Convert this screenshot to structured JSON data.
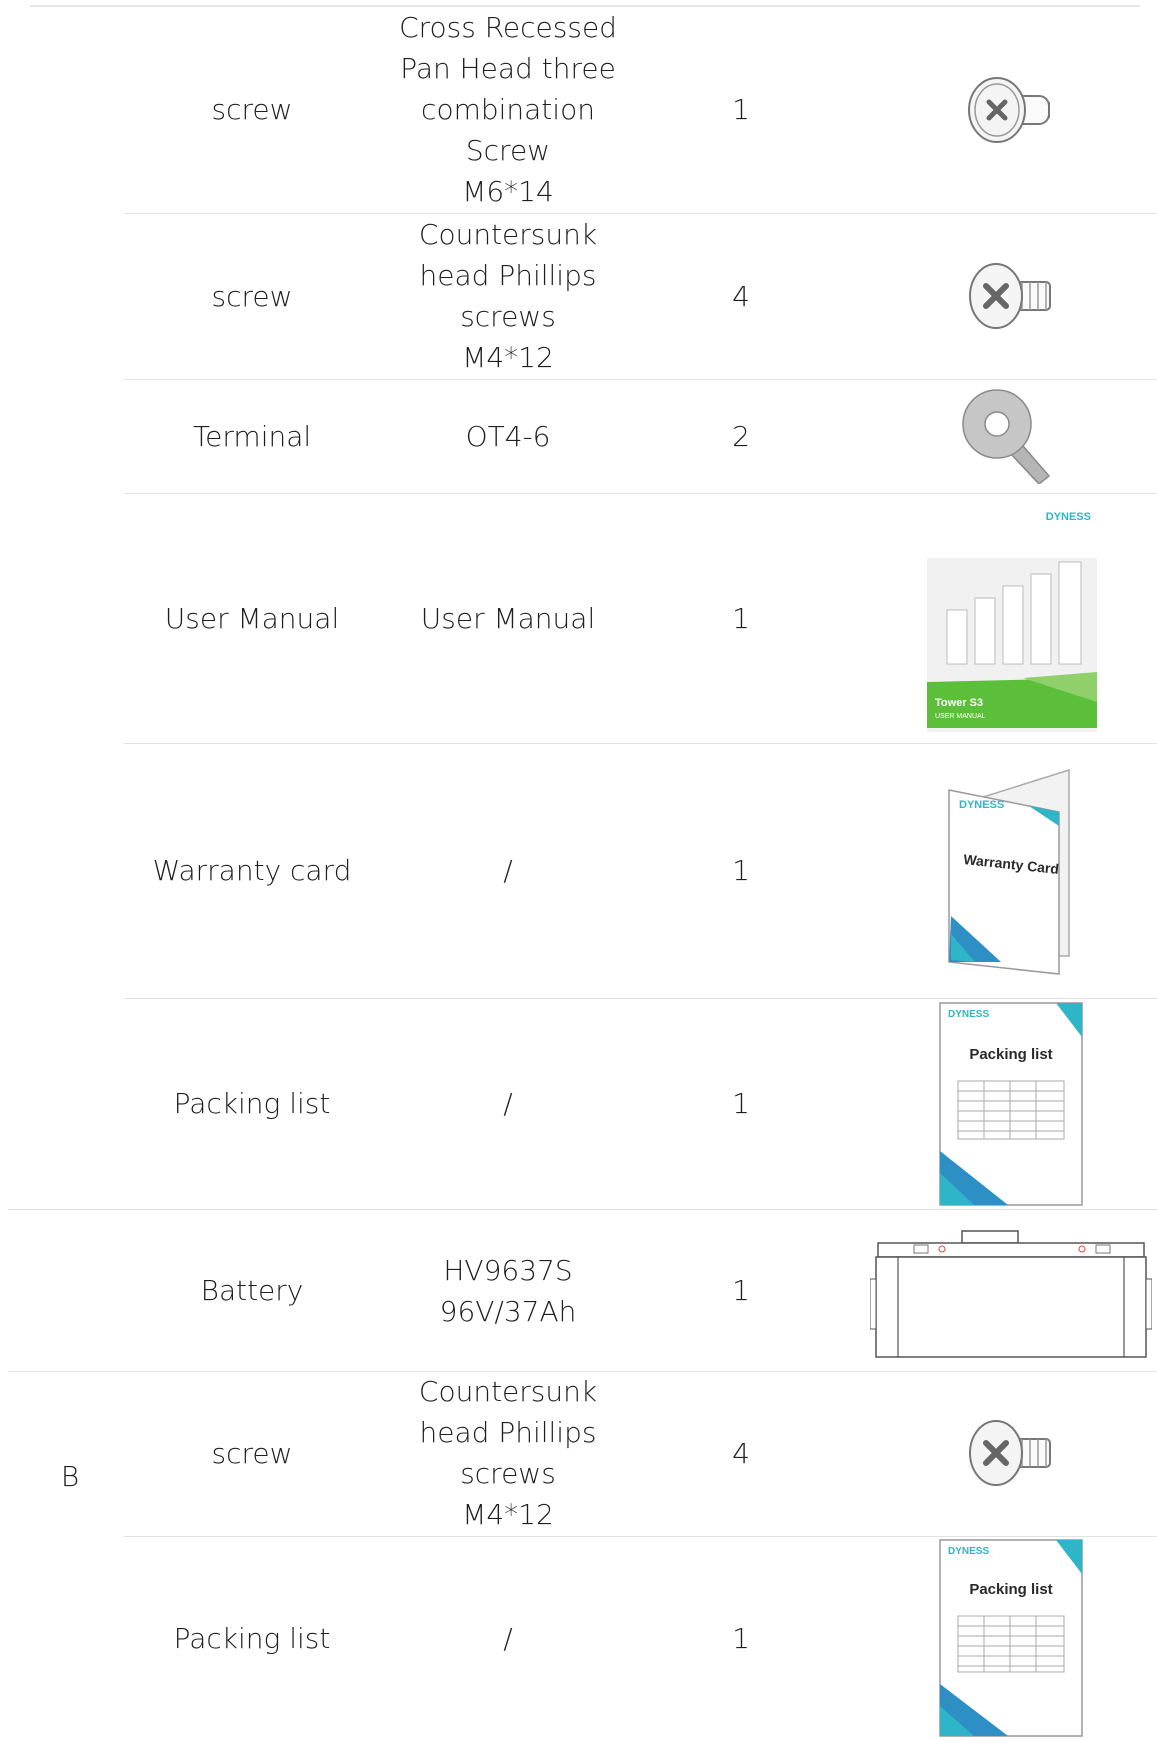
{
  "rows": [
    {
      "name": "screw",
      "spec": "Cross Recessed\nPan Head three\ncombination\nScrew\nM6*14",
      "qty": "1",
      "image": "pan-head-combination-screw-icon"
    },
    {
      "name": "screw",
      "spec": "Countersunk\nhead Phillips\nscrews\nM4*12",
      "qty": "4",
      "image": "countersunk-screw-icon"
    },
    {
      "name": "Terminal",
      "spec": "OT4-6",
      "qty": "2",
      "image": "ring-terminal-icon"
    },
    {
      "name": "User Manual",
      "spec": "User Manual",
      "qty": "1",
      "image": "user-manual-cover-image"
    },
    {
      "name": "Warranty card",
      "spec": "/",
      "qty": "1",
      "image": "warranty-card-image"
    },
    {
      "name": "Packing list",
      "spec": "/",
      "qty": "1",
      "image": "packing-list-image"
    },
    {
      "name": "Battery",
      "spec": "HV9637S\n96V/37Ah",
      "qty": "1",
      "image": "battery-module-drawing"
    },
    {
      "name": "screw",
      "spec": "Countersunk\nhead Phillips\nscrews\nM4*12",
      "qty": "4",
      "image": "countersunk-screw-icon"
    },
    {
      "name": "Packing list",
      "spec": "/",
      "qty": "1",
      "image": "packing-list-image"
    }
  ],
  "groups": [
    {
      "label": "B"
    }
  ],
  "artwork": {
    "brand": "DYNESS",
    "manual_title": "Tower S3",
    "manual_subtitle": "USER MANUAL",
    "warranty_title": "Warranty Card",
    "packing_title": "Packing list"
  },
  "colors": {
    "manual_green": "#5bbf3a",
    "brand_blue": "#2e8fc4",
    "brand_teal": "#2fb5c8",
    "rule_gray": "#e2e2e2"
  }
}
